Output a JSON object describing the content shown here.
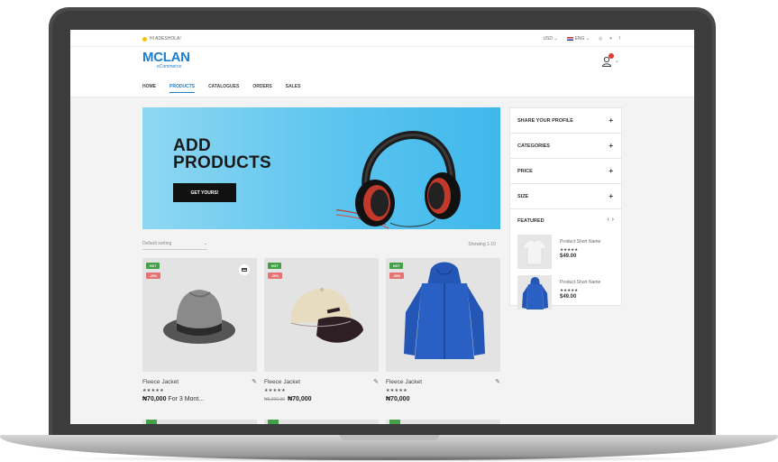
{
  "topbar": {
    "greeting": "HI ADESHOLA!",
    "currency": "USD",
    "language": "ENG"
  },
  "logo": {
    "main": "MCLAN",
    "sub": "eCommerce"
  },
  "nav": {
    "items": [
      "HOME",
      "PRODUCTS",
      "CATALOGUES",
      "ORDERS",
      "SALES"
    ],
    "active": "PRODUCTS"
  },
  "banner": {
    "title_line1": "ADD",
    "title_line2": "PRODUCTS",
    "button": "GET YOURS!"
  },
  "listing": {
    "sort_label": "Default sorting",
    "showing": "Showing 1-10"
  },
  "products": [
    {
      "name": "Fleece Jacket",
      "stars": "★★★★★",
      "price": "₦70,000",
      "price_term": " For 3 Mont...",
      "tag_hot": "HOT",
      "tag_sale": "-20%",
      "image": "hat-icon"
    },
    {
      "name": "Fleece Jacket",
      "stars": "★★★★★",
      "old_price": "₦5,000.00",
      "price": "₦70,000",
      "tag_hot": "HOT",
      "tag_sale": "-20%",
      "image": "cap-icon"
    },
    {
      "name": "Fleece Jacket",
      "stars": "★★★★★",
      "price": "₦70,000",
      "tag_hot": "HOT",
      "tag_sale": "-20%",
      "image": "hoodie-icon"
    }
  ],
  "sidebar": {
    "sections": [
      "SHARE YOUR PROFILE",
      "CATEGORIES",
      "PRICE",
      "SIZE"
    ],
    "featured_title": "FEATURED",
    "featured": [
      {
        "name": "Product Short Name",
        "stars": "★★★★★",
        "price": "$49.00",
        "image": "tshirt-icon"
      },
      {
        "name": "Product Short Name",
        "stars": "★★★★★",
        "price": "$49.00",
        "image": "hoodie-icon"
      }
    ]
  },
  "colors": {
    "brand": "#1b7fcf",
    "hot_tag": "#43a047",
    "sale_tag": "#e57373",
    "banner_bg": "#5bc4ef"
  }
}
